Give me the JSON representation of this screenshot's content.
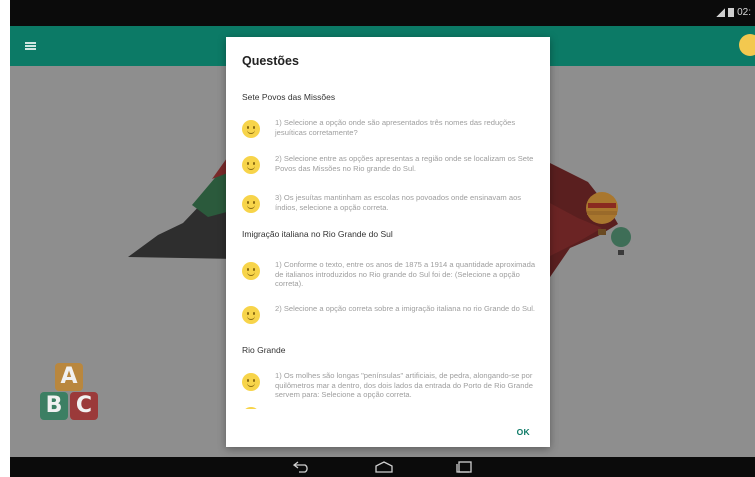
{
  "status_bar": {
    "time": "02:"
  },
  "dialog": {
    "title": "Questões",
    "ok_label": "OK",
    "sections": [
      {
        "title": "Sete Povos das Missões",
        "questions": [
          "1) Selecione a opção onde são apresentados três nomes das reduções jesuíticas corretamente?",
          "2) Selecione entre as opções apresentas a região onde se localizam os Sete Povos das Missões no Rio grande do Sul.",
          "3) Os jesuítas mantinham as escolas nos povoados onde ensinavam aos índios, selecione a opção correta."
        ]
      },
      {
        "title": "Imigração italiana no Rio Grande do Sul",
        "questions": [
          "1) Conforme o texto, entre os anos de 1875 a 1914 a quantidade aproximada de italianos introduzidos no Rio grande do Sul foi de: (Selecione a opção correta).",
          "2) Selecione a opção correta sobre a imigração italiana no rio Grande do Sul."
        ]
      },
      {
        "title": "Rio Grande",
        "questions": [
          "1) Os molhes são longas \"penínsulas\" artificiais, de pedra, alongando-se por quilômetros mar a dentro, dos dois lados da entrada do Porto de Rio Grande servem para: Selecione a opção correta."
        ]
      }
    ]
  },
  "blocks": {
    "a": "A",
    "b": "B",
    "c": "C"
  },
  "colors": {
    "app_bar": "#0c7a66",
    "accent": "#0c7a66",
    "smiley": "#f7d44a"
  }
}
